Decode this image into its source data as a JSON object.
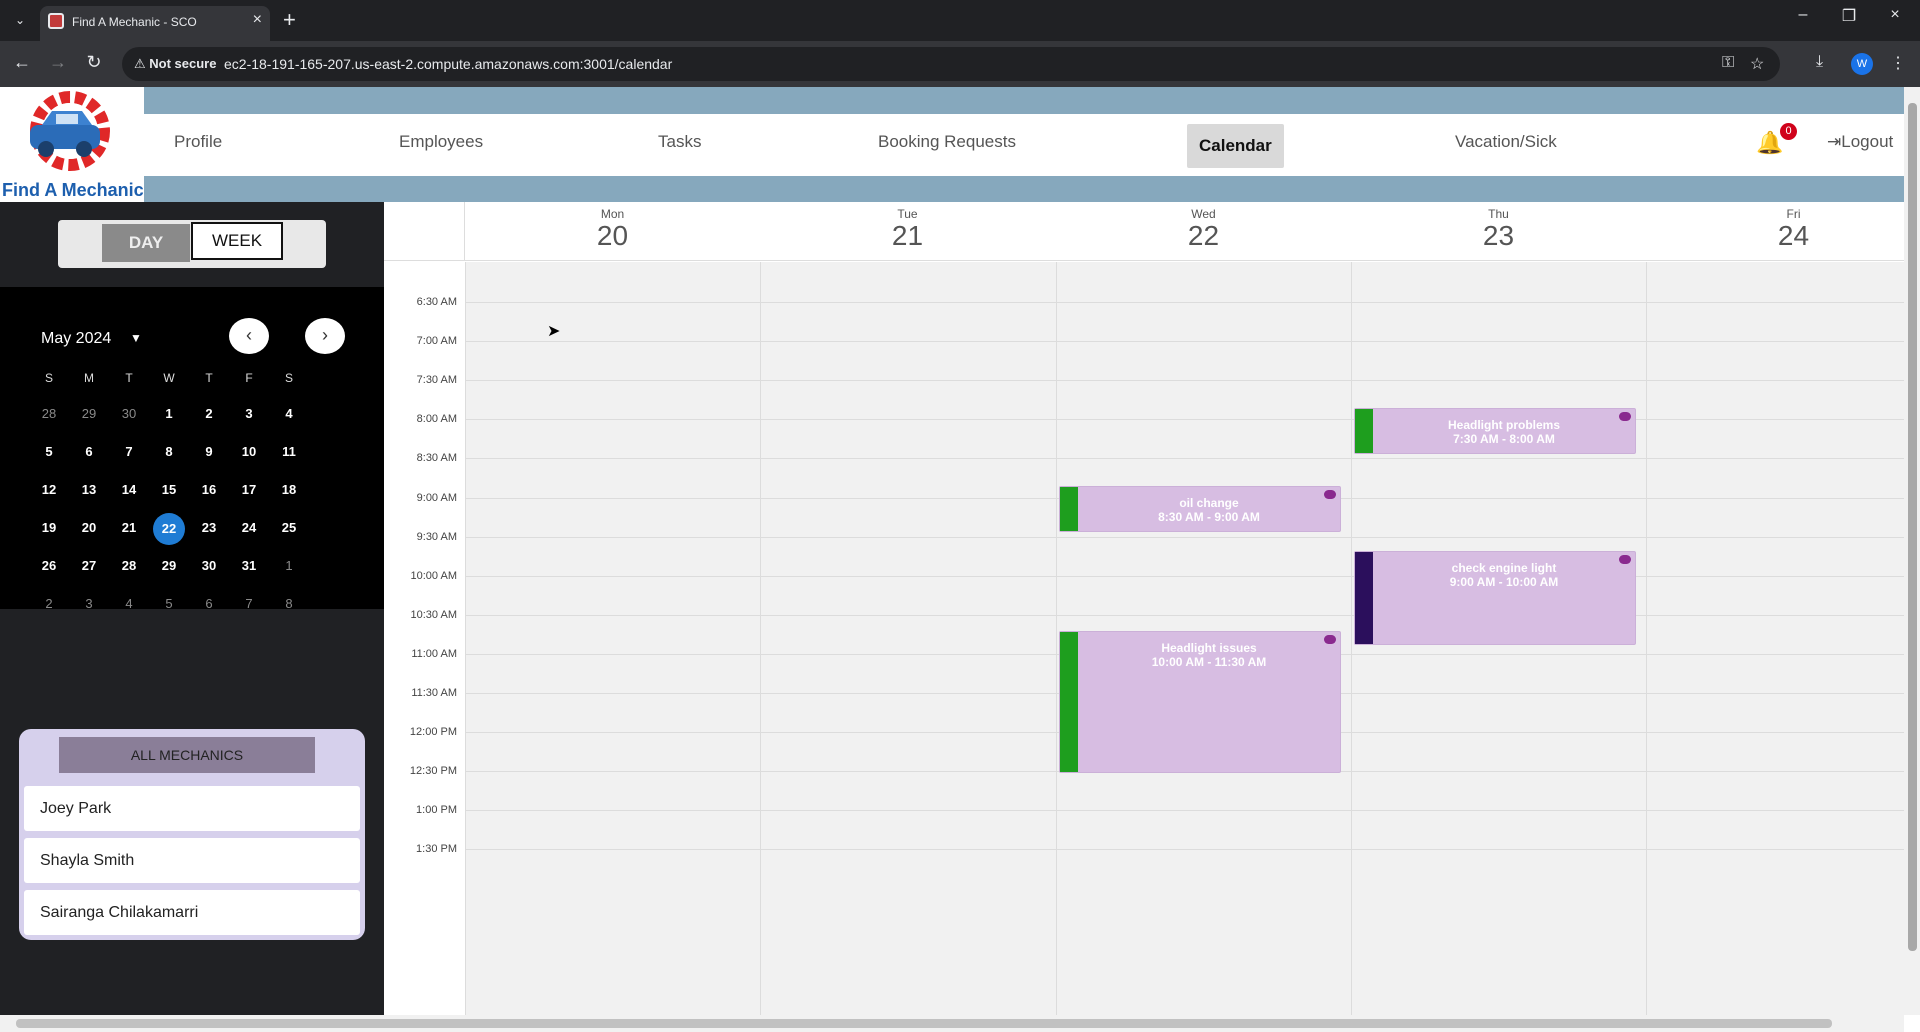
{
  "browser": {
    "tab_title": "Find A Mechanic - SCO",
    "security_label": "Not secure",
    "url": "ec2-18-191-165-207.us-east-2.compute.amazonaws.com:3001/calendar",
    "profile_initial": "W"
  },
  "app": {
    "logo_text": "Find A Mechanic",
    "nav": {
      "profile": "Profile",
      "employees": "Employees",
      "tasks": "Tasks",
      "booking_requests": "Booking Requests",
      "calendar": "Calendar",
      "vacation": "Vacation/Sick",
      "logout": "Logout"
    },
    "notification_count": "0"
  },
  "sidebar": {
    "toggle_day": "DAY",
    "toggle_week": "WEEK",
    "month_label": "May 2024",
    "weekdays": [
      "S",
      "M",
      "T",
      "W",
      "T",
      "F",
      "S"
    ],
    "weeks": [
      [
        "28",
        "29",
        "30",
        "1",
        "2",
        "3",
        "4"
      ],
      [
        "5",
        "6",
        "7",
        "8",
        "9",
        "10",
        "11"
      ],
      [
        "12",
        "13",
        "14",
        "15",
        "16",
        "17",
        "18"
      ],
      [
        "19",
        "20",
        "21",
        "22",
        "23",
        "24",
        "25"
      ],
      [
        "26",
        "27",
        "28",
        "29",
        "30",
        "31",
        "1"
      ],
      [
        "2",
        "3",
        "4",
        "5",
        "6",
        "7",
        "8"
      ]
    ],
    "selected_day": "22",
    "all_mechanics_label": "ALL MECHANICS",
    "mechanics": [
      "Joey Park",
      "Shayla Smith",
      "Sairanga Chilakamarri"
    ]
  },
  "calendar": {
    "days": [
      {
        "name": "Mon",
        "date": "20"
      },
      {
        "name": "Tue",
        "date": "21"
      },
      {
        "name": "Wed",
        "date": "22"
      },
      {
        "name": "Thu",
        "date": "23"
      },
      {
        "name": "Fri",
        "date": "24"
      }
    ],
    "times": [
      "6:30 AM",
      "7:00 AM",
      "7:30 AM",
      "8:00 AM",
      "8:30 AM",
      "9:00 AM",
      "9:30 AM",
      "10:00 AM",
      "10:30 AM",
      "11:00 AM",
      "11:30 AM",
      "12:00 PM",
      "12:30 PM",
      "1:00 PM",
      "1:30 PM"
    ],
    "events": [
      {
        "title": "Headlight problems",
        "time": "7:30 AM  -  8:00 AM",
        "day": "Thu",
        "bar_color": "#1e9e1e"
      },
      {
        "title": "oil change",
        "time": "8:30 AM  -  9:00 AM",
        "day": "Wed",
        "bar_color": "#1e9e1e"
      },
      {
        "title": "check engine light",
        "time": "9:00 AM  -  10:00 AM",
        "day": "Thu",
        "bar_color": "#2b0f5c"
      },
      {
        "title": "Headlight issues",
        "time": "10:00 AM  -  11:30 AM",
        "day": "Wed",
        "bar_color": "#1e9e1e"
      }
    ]
  },
  "colors": {
    "accent_strip": "#86a8bd",
    "event_bg": "#d7bde2",
    "selected_day": "#1f7cd4"
  }
}
